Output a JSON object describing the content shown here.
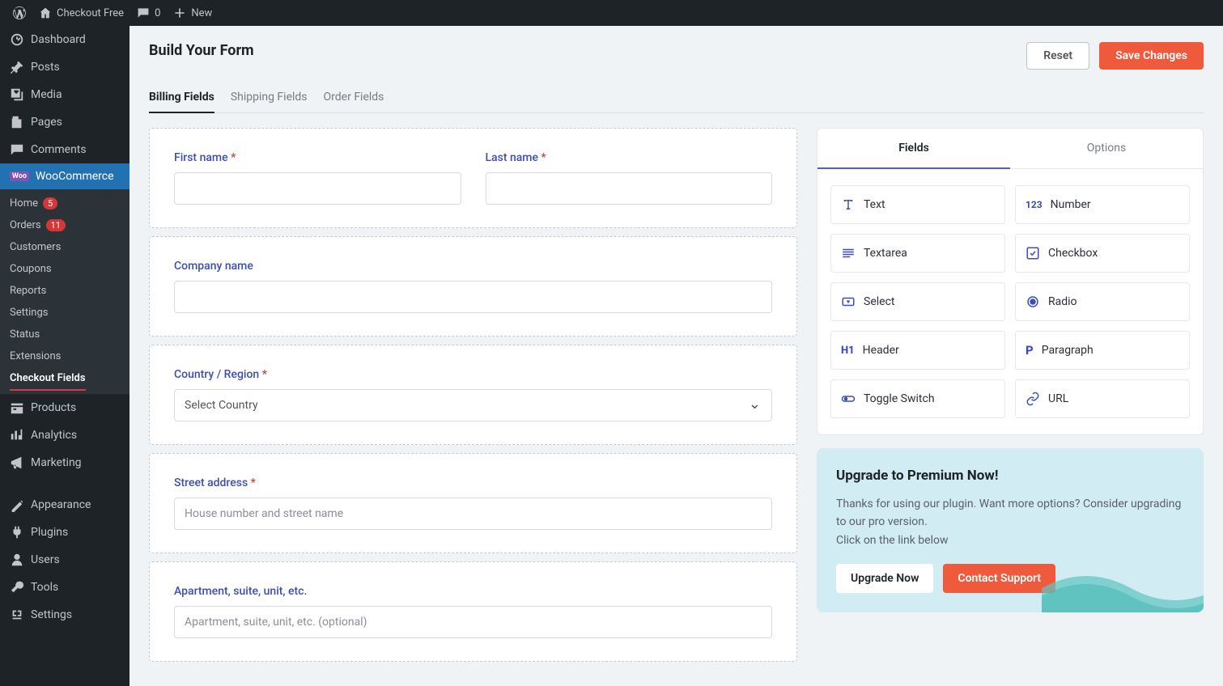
{
  "admin_bar": {
    "site": "Checkout Free",
    "comments": "0",
    "new": "New"
  },
  "sidebar": {
    "dashboard": "Dashboard",
    "posts": "Posts",
    "media": "Media",
    "pages": "Pages",
    "comments": "Comments",
    "woocommerce": "WooCommerce",
    "products": "Products",
    "analytics": "Analytics",
    "marketing": "Marketing",
    "appearance": "Appearance",
    "plugins": "Plugins",
    "users": "Users",
    "tools": "Tools",
    "settings": "Settings"
  },
  "woo_sub": {
    "home": "Home",
    "home_count": "5",
    "orders": "Orders",
    "orders_count": "11",
    "customers": "Customers",
    "coupons": "Coupons",
    "reports": "Reports",
    "settings": "Settings",
    "status": "Status",
    "extensions": "Extensions",
    "checkout_fields": "Checkout Fields"
  },
  "page": {
    "title": "Build Your Form",
    "reset": "Reset",
    "save": "Save Changes"
  },
  "main_tabs": {
    "billing": "Billing Fields",
    "shipping": "Shipping Fields",
    "order": "Order Fields"
  },
  "form": {
    "first_name": "First name",
    "last_name": "Last name",
    "company": "Company name",
    "country": "Country / Region",
    "country_placeholder": "Select Country",
    "street": "Street address",
    "street_placeholder": "House number and street name",
    "apartment": "Apartment, suite, unit, etc.",
    "apartment_placeholder": "Apartment, suite, unit, etc. (optional)"
  },
  "side_tabs": {
    "fields": "Fields",
    "options": "Options"
  },
  "field_types": {
    "text": "Text",
    "number": "Number",
    "textarea": "Textarea",
    "checkbox": "Checkbox",
    "select": "Select",
    "radio": "Radio",
    "header": "Header",
    "paragraph": "Paragraph",
    "toggle": "Toggle Switch",
    "url": "URL"
  },
  "upgrade": {
    "title": "Upgrade to Premium Now!",
    "text": "Thanks for using our plugin. Want more options? Consider upgrading to our pro version.\nClick on the link below",
    "upgrade_btn": "Upgrade Now",
    "contact_btn": "Contact Support"
  }
}
